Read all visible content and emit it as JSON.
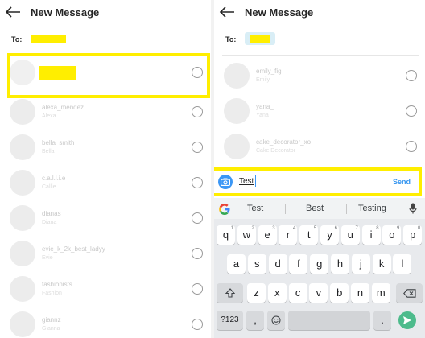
{
  "left": {
    "header": {
      "title": "New Message"
    },
    "to_label": "To:",
    "contacts": [
      {
        "name": "",
        "sub": ""
      },
      {
        "name": "alexa_mendez",
        "sub": "Alexa"
      },
      {
        "name": "bella_smith",
        "sub": "Bella"
      },
      {
        "name": "c.a.l.l.i.e",
        "sub": "Callie"
      },
      {
        "name": "dianas",
        "sub": "Diana"
      },
      {
        "name": "evie_k_2k_best_ladyy",
        "sub": "Evie"
      },
      {
        "name": "fashionists",
        "sub": "Fashion"
      },
      {
        "name": "giannz",
        "sub": "Gianna"
      }
    ]
  },
  "right": {
    "header": {
      "title": "New Message"
    },
    "to_label": "To:",
    "contacts": [
      {
        "name": "emily_fig",
        "sub": "Emily"
      },
      {
        "name": "yana_",
        "sub": "Yana"
      },
      {
        "name": "cake_decorator_xo",
        "sub": "Cake Decorator"
      }
    ],
    "compose": {
      "text": "Test",
      "send_label": "Send"
    },
    "keyboard": {
      "suggestions": [
        "Test",
        "Best",
        "Testing"
      ],
      "row1": [
        "q",
        "w",
        "e",
        "r",
        "t",
        "y",
        "u",
        "i",
        "o",
        "p"
      ],
      "row1_hints": [
        "1",
        "2",
        "3",
        "4",
        "5",
        "6",
        "7",
        "8",
        "9",
        "0"
      ],
      "row2": [
        "a",
        "s",
        "d",
        "f",
        "g",
        "h",
        "j",
        "k",
        "l"
      ],
      "row3": [
        "z",
        "x",
        "c",
        "v",
        "b",
        "n",
        "m"
      ],
      "symbols_label": "?123",
      "comma": ",",
      "period": "."
    }
  }
}
